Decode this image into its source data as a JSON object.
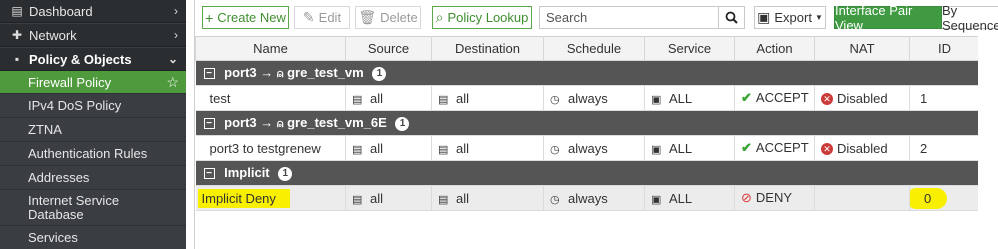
{
  "sidebar": {
    "items": [
      {
        "label": "Dashboard",
        "icon": "dashboard-icon",
        "glyph": "▤",
        "chev": "›"
      },
      {
        "label": "Network",
        "icon": "network-icon",
        "glyph": "✚",
        "chev": "›"
      },
      {
        "label": "Policy & Objects",
        "icon": "policy-icon",
        "glyph": "▪",
        "chev": "⌄"
      }
    ],
    "subitems": [
      "Firewall Policy",
      "IPv4 DoS Policy",
      "ZTNA",
      "Authentication Rules",
      "Addresses",
      "Internet Service Database",
      "Services"
    ]
  },
  "toolbar": {
    "create_new": "Create New",
    "edit": "Edit",
    "delete": "Delete",
    "policy_lookup": "Policy Lookup",
    "search_placeholder": "Search",
    "export": "Export",
    "interface_pair_view": "Interface Pair View",
    "by_sequence": "By Sequence"
  },
  "table": {
    "columns": [
      "Name",
      "Source",
      "Destination",
      "Schedule",
      "Service",
      "Action",
      "NAT",
      "ID"
    ],
    "groups": [
      {
        "from": "port3",
        "arrow": "→",
        "to": "gre_test_vm",
        "count": "1",
        "rows": [
          {
            "name": "test",
            "source": "all",
            "destination": "all",
            "schedule": "always",
            "service": "ALL",
            "action": "ACCEPT",
            "nat": "Disabled",
            "id": "1"
          }
        ]
      },
      {
        "from": "port3",
        "arrow": "→",
        "to": "gre_test_vm_6E",
        "count": "1",
        "rows": [
          {
            "name": "port3 to testgrenew",
            "source": "all",
            "destination": "all",
            "schedule": "always",
            "service": "ALL",
            "action": "ACCEPT",
            "nat": "Disabled",
            "id": "2"
          }
        ]
      }
    ],
    "implicit": {
      "label": "Implicit",
      "count": "1",
      "row": {
        "name": "Implicit Deny",
        "source": "all",
        "destination": "all",
        "schedule": "always",
        "service": "ALL",
        "action": "DENY",
        "id": "0"
      }
    }
  },
  "colors": {
    "accent": "#4f9a3c",
    "sidebar": "#3a3e42",
    "group_header": "#555555",
    "highlight": "#f8f000"
  }
}
